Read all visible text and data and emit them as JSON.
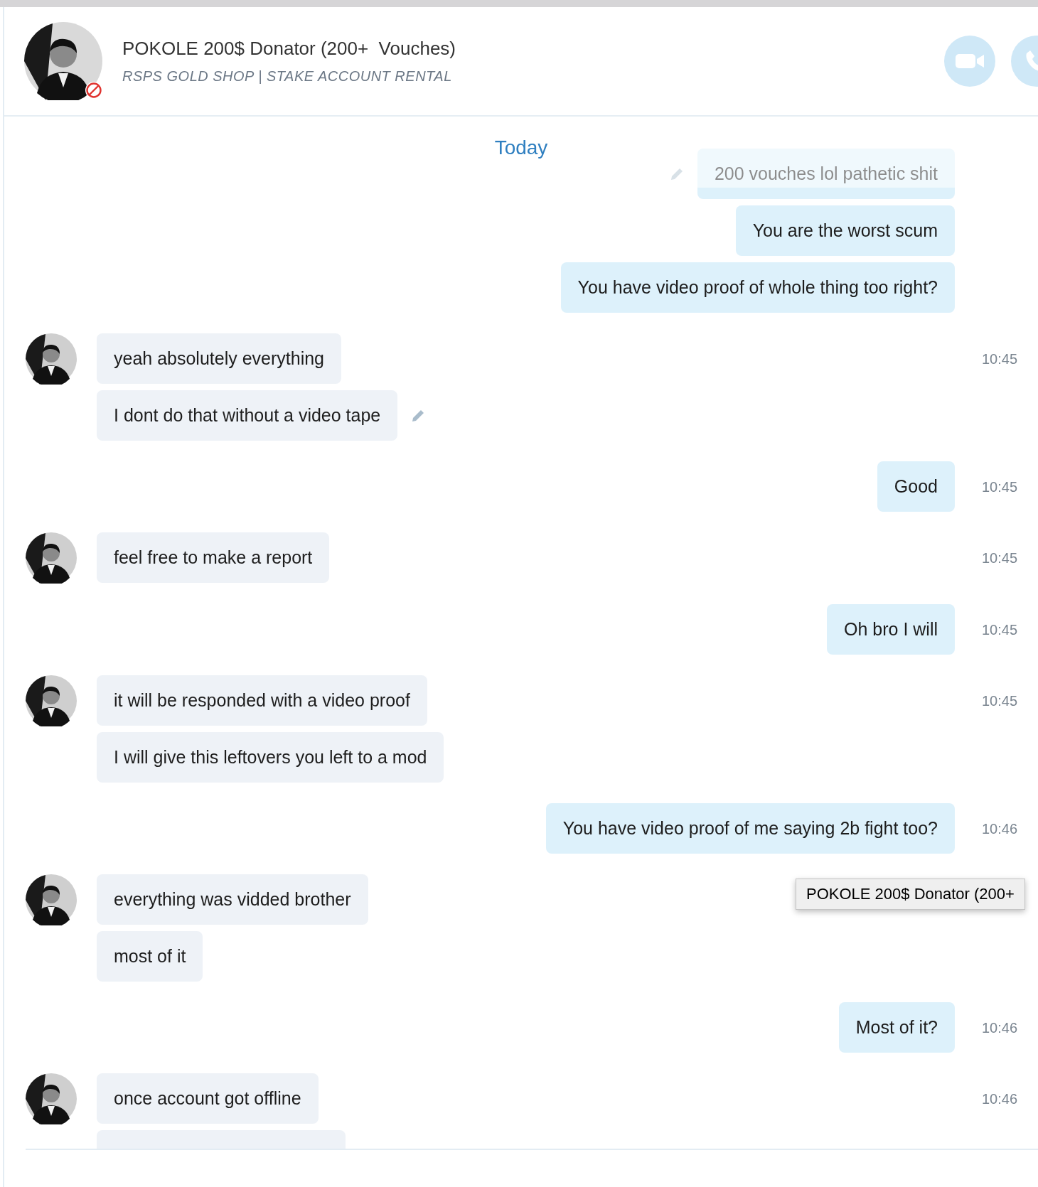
{
  "header": {
    "title": "POKOLE 200$ Donator (200+  Vouches)",
    "subtitle": "RSPS GOLD SHOP | STAKE ACCOUNT RENTAL",
    "blocked": true
  },
  "date_divider": "Today",
  "groups": [
    {
      "kind": "out",
      "messages": [
        {
          "kind": "text",
          "text": "200 vouches lol pathetic shit",
          "edited": true
        },
        {
          "kind": "text",
          "text": "You are the worst scum",
          "edited": false
        },
        {
          "kind": "text",
          "text": "You have video proof of whole thing too right?",
          "edited": false
        }
      ]
    },
    {
      "kind": "in",
      "time": "10:45",
      "messages": [
        {
          "kind": "text",
          "text": "yeah absolutely everything",
          "edited": false
        },
        {
          "kind": "text",
          "text": "I dont do that without a video tape",
          "edited": true
        }
      ]
    },
    {
      "kind": "out",
      "time": "10:45",
      "messages": [
        {
          "kind": "text",
          "text": "Good",
          "edited": false
        }
      ]
    },
    {
      "kind": "in",
      "time": "10:45",
      "messages": [
        {
          "kind": "text",
          "text": "feel free to make a report",
          "edited": false
        }
      ]
    },
    {
      "kind": "out",
      "time": "10:45",
      "messages": [
        {
          "kind": "text",
          "text": "Oh bro I will",
          "edited": false
        }
      ]
    },
    {
      "kind": "in",
      "time": "10:45",
      "messages": [
        {
          "kind": "text",
          "text": "it will be responded with a video proof",
          "edited": false
        },
        {
          "kind": "text",
          "text": "I will give this leftovers you left to a mod",
          "edited": false
        }
      ]
    },
    {
      "kind": "out",
      "time": "10:46",
      "messages": [
        {
          "kind": "text",
          "text": "You have video proof of me saying 2b fight too?",
          "edited": false
        }
      ]
    },
    {
      "kind": "in",
      "messages": [
        {
          "kind": "text",
          "text": "everything was vidded brother",
          "edited": false
        },
        {
          "kind": "text",
          "text": "most of it",
          "edited": false
        }
      ]
    },
    {
      "kind": "out",
      "time": "10:46",
      "messages": [
        {
          "kind": "text",
          "text": "Most of it?",
          "edited": false
        }
      ]
    },
    {
      "kind": "in",
      "time": "10:46",
      "messages": [
        {
          "kind": "text",
          "text": "once account got offline",
          "edited": false
        },
        {
          "kind": "partial"
        }
      ]
    }
  ],
  "tooltip": "POKOLE 200$ Donator (200+"
}
